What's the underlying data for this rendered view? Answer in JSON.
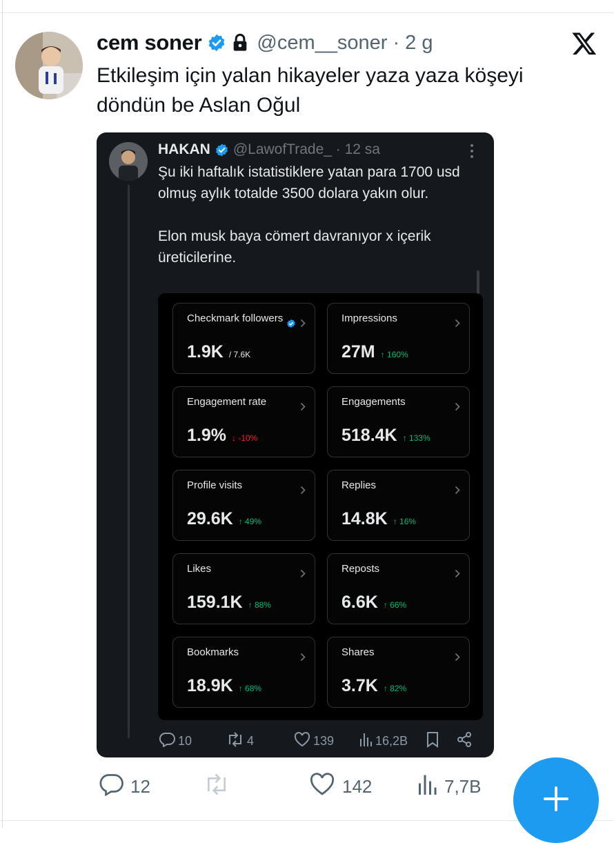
{
  "tweet": {
    "author_name": "cem soner",
    "handle_time": "@cem__soner · 2 g",
    "text": "Etkileşim için yalan hikayeler yaza yaza köşeyi döndün be Aslan Oğul",
    "actions": {
      "replies": "12",
      "likes": "142",
      "views": "7,7B"
    }
  },
  "quoted": {
    "author_name": "HAKAN",
    "handle_time": "@LawofTrade_ · 12 sa",
    "text_p1": "Şu iki haftalık  istatistiklere  yatan para 1700 usd olmuş aylık totalde 3500 dolara yakın olur.",
    "text_p2": "Elon musk baya cömert davranıyor x içerik üreticilerine.",
    "actions": {
      "replies": "10",
      "reposts": "4",
      "likes": "139",
      "views": "16,2B"
    },
    "stats": [
      {
        "label": "Checkmark followers",
        "value": "1.9K",
        "change": "/ 7.6K",
        "trend": "none"
      },
      {
        "label": "Impressions",
        "value": "27M",
        "change": "↑ 160%",
        "trend": "up"
      },
      {
        "label": "Engagement rate",
        "value": "1.9%",
        "change": "↓ -10%",
        "trend": "down"
      },
      {
        "label": "Engagements",
        "value": "518.4K",
        "change": "↑ 133%",
        "trend": "up"
      },
      {
        "label": "Profile visits",
        "value": "29.6K",
        "change": "↑ 49%",
        "trend": "up"
      },
      {
        "label": "Replies",
        "value": "14.8K",
        "change": "↑ 16%",
        "trend": "up"
      },
      {
        "label": "Likes",
        "value": "159.1K",
        "change": "↑ 88%",
        "trend": "up"
      },
      {
        "label": "Reposts",
        "value": "6.6K",
        "change": "↑ 66%",
        "trend": "up"
      },
      {
        "label": "Bookmarks",
        "value": "18.9K",
        "change": "↑ 68%",
        "trend": "up"
      },
      {
        "label": "Shares",
        "value": "3.7K",
        "change": "↑ 82%",
        "trend": "up"
      }
    ]
  },
  "icons": {
    "verified": "verified-badge-icon",
    "lock": "lock-icon",
    "x_logo": "x-logo-icon",
    "reply": "reply-icon",
    "repost": "repost-icon",
    "like": "heart-icon",
    "views": "views-icon",
    "bookmark": "bookmark-icon",
    "share": "share-icon",
    "compose": "plus-icon"
  },
  "colors": {
    "accent": "#1d9bf0",
    "up": "#00ba7c",
    "down": "#f4212e",
    "card_bg": "#15181c"
  }
}
